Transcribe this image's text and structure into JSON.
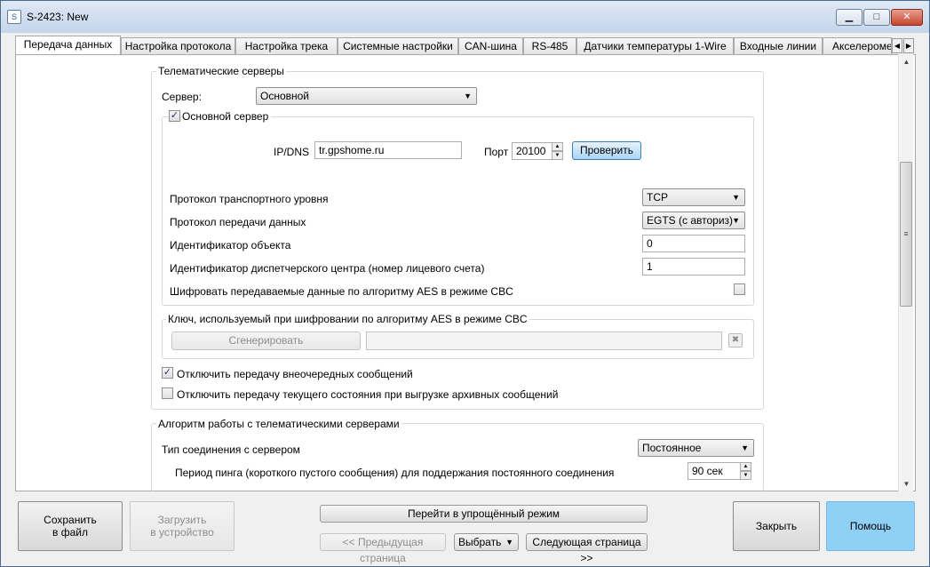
{
  "window": {
    "title": "S-2423: New",
    "app_icon": "gps-app-icon",
    "minimize_icon": "▁",
    "maximize_icon": "□",
    "close_icon": "✕"
  },
  "tabs": [
    {
      "label": "Передача данных",
      "active": true
    },
    {
      "label": "Настройка протокола"
    },
    {
      "label": "Настройка трека"
    },
    {
      "label": "Системные настройки"
    },
    {
      "label": "CAN-шина"
    },
    {
      "label": "RS-485"
    },
    {
      "label": "Датчики температуры 1-Wire"
    },
    {
      "label": "Входные линии"
    },
    {
      "label": "Акселерометр"
    }
  ],
  "tab_scroll": {
    "left_icon": "◀",
    "right_icon": "▶"
  },
  "telematics": {
    "legend": "Телематические серверы",
    "server_label": "Сервер:",
    "server_value": "Основной",
    "main_server_checkbox": "Основной сервер",
    "main_server_checked": true,
    "ip_label": "IP/DNS",
    "ip_value": "tr.gpshome.ru",
    "port_label": "Порт",
    "port_value": "20100",
    "check_button": "Проверить",
    "transport_label": "Протокол транспортного уровня",
    "transport_value": "TCP",
    "data_protocol_label": "Протокол передачи данных",
    "data_protocol_value": "EGTS (с авториз)",
    "object_id_label": "Идентификатор объекта",
    "object_id_value": "0",
    "dispatcher_id_label": "Идентификатор диспетчерского центра (номер лицевого счета)",
    "dispatcher_id_value": "1",
    "aes_label": "Шифровать передаваемые данные по алгоритму AES в режиме CBC",
    "aes_checked": false,
    "aes_key_legend": "Ключ, используемый при шифровании по алгоритму AES в режиме CBC",
    "generate_button": "Сгенерировать",
    "key_value": "",
    "disable_extra_label": "Отключить передачу внеочередных сообщений",
    "disable_extra_checked": true,
    "disable_current_label": "Отключить передачу текущего состояния при выгрузке архивных сообщений",
    "disable_current_checked": false
  },
  "algorithm": {
    "legend": "Алгоритм работы с телематическими серверами",
    "connection_type_label": "Тип соединения с сервером",
    "connection_type_value": "Постоянное",
    "ping_label": "Период пинга (короткого пустого сообщения) для поддержания постоянного соединения",
    "ping_value": "90 сек"
  },
  "footer": {
    "save_button": "Сохранить\nв файл",
    "load_button": "Загрузить\nв устройство",
    "simple_mode_button": "Перейти в упрощённый режим",
    "prev_page_button": "<< Предыдущая страница",
    "select_button": "Выбрать",
    "next_page_button": "Следующая страница >>",
    "close_button": "Закрыть",
    "help_button": "Помощь"
  },
  "glyphs": {
    "check": "✓",
    "dropdown": "▼",
    "up": "▲",
    "down": "▼",
    "grip": "≡",
    "clear": "✖"
  }
}
